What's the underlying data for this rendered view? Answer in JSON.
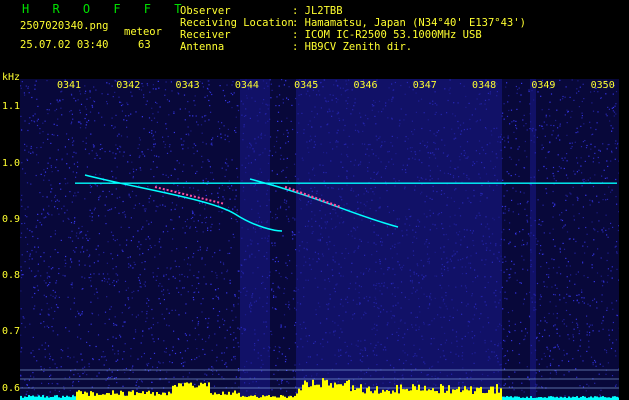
{
  "app": {
    "logo": "H R O F F T"
  },
  "file": {
    "name": "2507020340.png",
    "kind": "meteor",
    "datetime": "25.07.02 03:40",
    "count": "63"
  },
  "station": {
    "labels": [
      "Observer",
      "Receiving Location",
      "Receiver",
      "Antenna"
    ],
    "values": [
      ": JL2TBB",
      ": Hamamatsu, Japan (N34°40' E137°43')",
      ": ICOM IC-R2500 53.1000MHz USB",
      ": HB9CV Zenith dir."
    ]
  },
  "chart_data": {
    "type": "heatmap",
    "xlabel": "",
    "ylabel": "kHz",
    "x_ticks": [
      "0341",
      "0342",
      "0343",
      "0344",
      "0345",
      "0346",
      "0347",
      "0348",
      "0349",
      "0350"
    ],
    "y_ticks": [
      "1.1",
      "1.0",
      "0.9",
      "0.8",
      "0.7",
      "0.6"
    ],
    "ylim": [
      0.58,
      1.15
    ],
    "xlim": [
      "03:41",
      "03:51"
    ],
    "carrier_khz": 0.965,
    "colors": {
      "background": "#0a0a40",
      "noise": "#3c3cff",
      "carrier": "#00ffff",
      "trace": "#ff50a0",
      "signal_bar": "#ffff00",
      "guide": "#a0c8ff",
      "axis_text": "#ffff30"
    }
  }
}
